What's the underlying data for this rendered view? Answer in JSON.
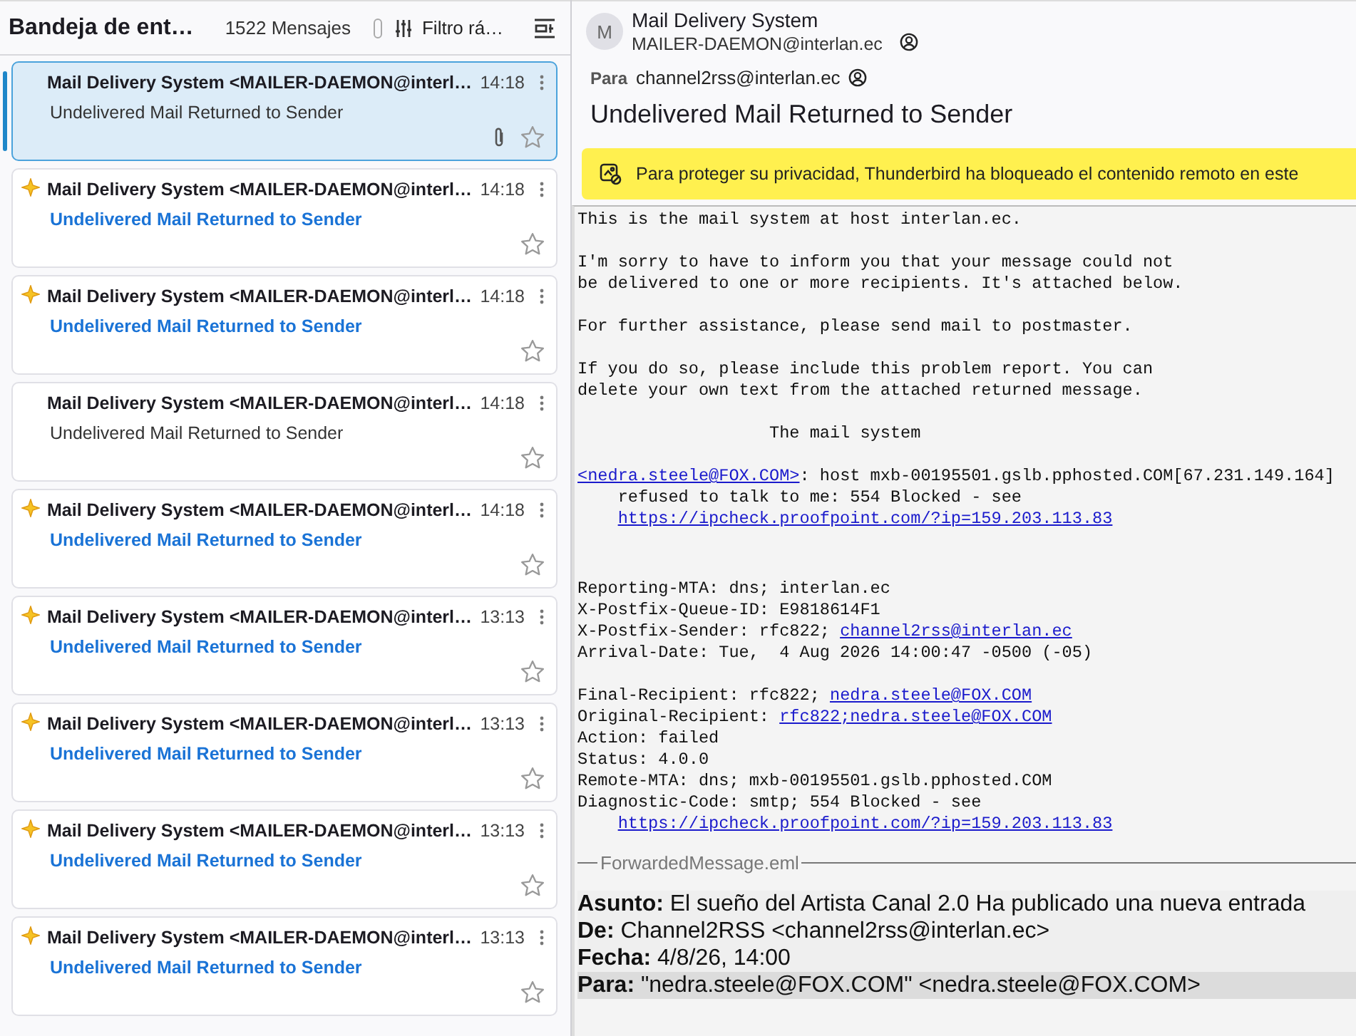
{
  "folder_pane": {
    "title": "Bandeja de ent…",
    "count": "1522 Mensajes",
    "quick_filter": "Filtro rá…"
  },
  "messages": [
    {
      "sender": "Mail Delivery System <MAILER-DAEMON@interl…",
      "time": "14:18",
      "subject": "Undelivered Mail Returned to Sender",
      "selected": true,
      "unread": false,
      "attachment": true,
      "starred": false
    },
    {
      "sender": "Mail Delivery System <MAILER-DAEMON@interl…",
      "time": "14:18",
      "subject": "Undelivered Mail Returned to Sender",
      "selected": false,
      "unread": true,
      "attachment": false,
      "starred": false
    },
    {
      "sender": "Mail Delivery System <MAILER-DAEMON@interl…",
      "time": "14:18",
      "subject": "Undelivered Mail Returned to Sender",
      "selected": false,
      "unread": true,
      "attachment": false,
      "starred": false
    },
    {
      "sender": "Mail Delivery System <MAILER-DAEMON@interl…",
      "time": "14:18",
      "subject": "Undelivered Mail Returned to Sender",
      "selected": false,
      "unread": false,
      "attachment": false,
      "starred": false
    },
    {
      "sender": "Mail Delivery System <MAILER-DAEMON@interl…",
      "time": "14:18",
      "subject": "Undelivered Mail Returned to Sender",
      "selected": false,
      "unread": true,
      "attachment": false,
      "starred": false
    },
    {
      "sender": "Mail Delivery System <MAILER-DAEMON@interl…",
      "time": "13:13",
      "subject": "Undelivered Mail Returned to Sender",
      "selected": false,
      "unread": true,
      "attachment": false,
      "starred": false
    },
    {
      "sender": "Mail Delivery System <MAILER-DAEMON@interl…",
      "time": "13:13",
      "subject": "Undelivered Mail Returned to Sender",
      "selected": false,
      "unread": true,
      "attachment": false,
      "starred": false
    },
    {
      "sender": "Mail Delivery System <MAILER-DAEMON@interl…",
      "time": "13:13",
      "subject": "Undelivered Mail Returned to Sender",
      "selected": false,
      "unread": true,
      "attachment": false,
      "starred": false
    },
    {
      "sender": "Mail Delivery System <MAILER-DAEMON@interl…",
      "time": "13:13",
      "subject": "Undelivered Mail Returned to Sender",
      "selected": false,
      "unread": true,
      "attachment": false,
      "starred": false
    }
  ],
  "message_header": {
    "avatar_letter": "M",
    "sender_name": "Mail Delivery System",
    "sender_email": "MAILER-DAEMON@interlan.ec",
    "to_label": "Para",
    "to": "channel2rss@interlan.ec",
    "subject": "Undelivered Mail Returned to Sender"
  },
  "remote_content_notice": "Para proteger su privacidad, Thunderbird ha bloqueado el contenido remoto en este",
  "body_parts": [
    {
      "paragraphs": [
        [
          [
            {
              "kind": "text",
              "text": "This is the mail system at host interlan.ec."
            }
          ]
        ],
        [
          [
            {
              "kind": "text",
              "text": "I'm sorry to have to inform you that your message could not"
            }
          ],
          [
            {
              "kind": "text",
              "text": "be delivered to one or more recipients. It's attached below."
            }
          ]
        ],
        [
          [
            {
              "kind": "text",
              "text": "For further assistance, please send mail to postmaster."
            }
          ]
        ],
        [
          [
            {
              "kind": "text",
              "text": "If you do so, please include this problem report. You can"
            }
          ],
          [
            {
              "kind": "text",
              "text": "delete your own text from the attached returned message."
            }
          ]
        ],
        [
          [
            {
              "kind": "text",
              "text": "                   The mail system"
            }
          ]
        ],
        [
          [
            {
              "kind": "link",
              "text": "<nedra.steele@FOX.COM>"
            },
            {
              "kind": "text",
              "text": ": host mxb-00195501.gslb.pphosted.COM[67.231.149.164]"
            }
          ],
          [
            {
              "kind": "text",
              "text": "    refused to talk to me: 554 Blocked - see"
            }
          ],
          [
            {
              "kind": "link",
              "text": "https://ipcheck.proofpoint.com/?ip=159.203.113.83",
              "indented": true
            }
          ]
        ]
      ]
    },
    {
      "paragraphs": [
        [
          [
            {
              "kind": "text",
              "text": "Reporting-MTA: dns; interlan.ec"
            }
          ],
          [
            {
              "kind": "text",
              "text": "X-Postfix-Queue-ID: E9818614F1"
            }
          ],
          [
            {
              "kind": "text",
              "text": "X-Postfix-Sender: rfc822; "
            },
            {
              "kind": "link",
              "text": "channel2rss@interlan.ec"
            }
          ],
          [
            {
              "kind": "text",
              "text": "Arrival-Date: Tue,  4 Aug 2026 14:00:47 -0500 (-05)"
            }
          ]
        ],
        [
          [
            {
              "kind": "text",
              "text": "Final-Recipient: rfc822; "
            },
            {
              "kind": "link",
              "text": "nedra.steele@FOX.COM"
            }
          ],
          [
            {
              "kind": "text",
              "text": "Original-Recipient: "
            },
            {
              "kind": "link",
              "text": "rfc822;nedra.steele@FOX.COM"
            }
          ],
          [
            {
              "kind": "text",
              "text": "Action: failed"
            }
          ],
          [
            {
              "kind": "text",
              "text": "Status: 4.0.0"
            }
          ],
          [
            {
              "kind": "text",
              "text": "Remote-MTA: dns; mxb-00195501.gslb.pphosted.COM"
            }
          ],
          [
            {
              "kind": "text",
              "text": "Diagnostic-Code: smtp; 554 Blocked - see"
            }
          ],
          [
            {
              "kind": "link",
              "text": "https://ipcheck.proofpoint.com/?ip=159.203.113.83",
              "indented": true
            }
          ]
        ]
      ]
    }
  ],
  "attachment": {
    "name": "ForwardedMessage.eml",
    "headers": [
      {
        "label": "Asunto:",
        "value": "El sueño del Artista Canal 2.0 Ha publicado una nueva entrada",
        "highlighted": false
      },
      {
        "label": "De:",
        "value": "Channel2RSS <channel2rss@interlan.ec>",
        "highlighted": false
      },
      {
        "label": "Fecha:",
        "value": "4/8/26, 14:00",
        "highlighted": false
      },
      {
        "label": "Para:",
        "value": "\"nedra.steele@FOX.COM\" <nedra.steele@FOX.COM>",
        "highlighted": true
      }
    ]
  }
}
